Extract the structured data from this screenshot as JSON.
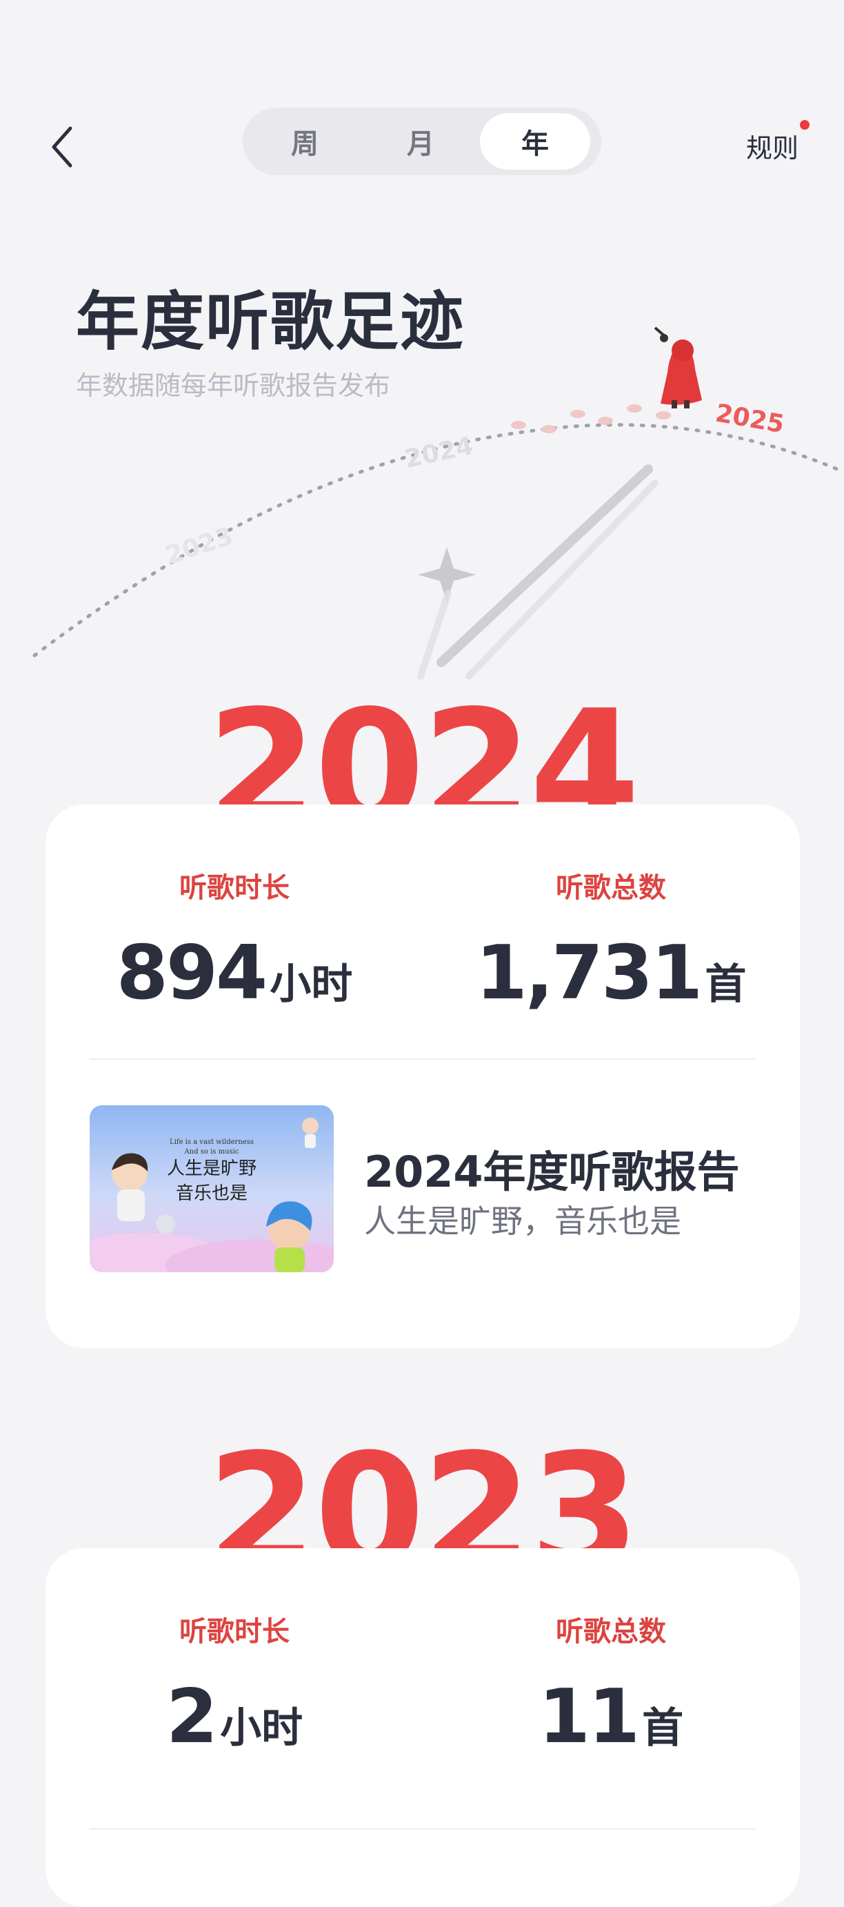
{
  "nav": {
    "tabs": [
      {
        "label": "周",
        "active": false
      },
      {
        "label": "月",
        "active": false
      },
      {
        "label": "年",
        "active": true
      }
    ],
    "rules_label": "规则"
  },
  "hero": {
    "title": "年度听歌足迹",
    "subtitle": "年数据随每年听歌报告发布",
    "timeline_labels": [
      "2023",
      "2024",
      "2025"
    ]
  },
  "years": [
    {
      "year": "2024",
      "duration_label": "听歌时长",
      "duration_value": "894",
      "duration_unit": "小时",
      "count_label": "听歌总数",
      "count_value": "1,731",
      "count_unit": "首",
      "report": {
        "title": "2024年度听歌报告",
        "subtitle": "人生是旷野，音乐也是",
        "thumb_en_line1": "Life is a vast wilderness",
        "thumb_en_line2": "And so is music",
        "thumb_cn_line1": "人生是旷野",
        "thumb_cn_line2": "音乐也是"
      }
    },
    {
      "year": "2023",
      "duration_label": "听歌时长",
      "duration_value": "2",
      "duration_unit": "小时",
      "count_label": "听歌总数",
      "count_value": "11",
      "count_unit": "首"
    }
  ],
  "colors": {
    "accent": "#ec4546",
    "background": "#f4f4f7",
    "text_dark": "#2b2f3d",
    "label_red": "#dc4440"
  }
}
